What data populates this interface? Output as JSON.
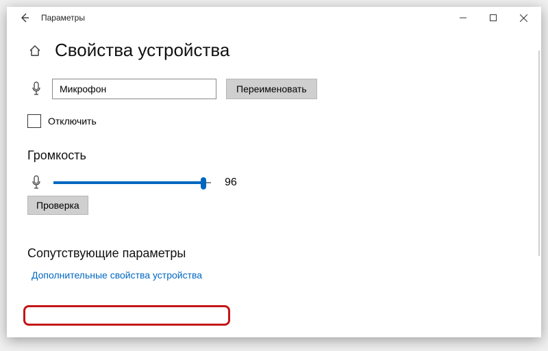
{
  "window": {
    "title": "Параметры"
  },
  "page": {
    "title": "Свойства устройства"
  },
  "device": {
    "name_value": "Микрофон",
    "rename_label": "Переименовать",
    "disable_label": "Отключить",
    "disable_checked": false
  },
  "volume": {
    "heading": "Громкость",
    "value": 96,
    "test_label": "Проверка"
  },
  "related": {
    "heading": "Сопутствующие параметры",
    "link_label": "Дополнительные свойства устройства"
  }
}
